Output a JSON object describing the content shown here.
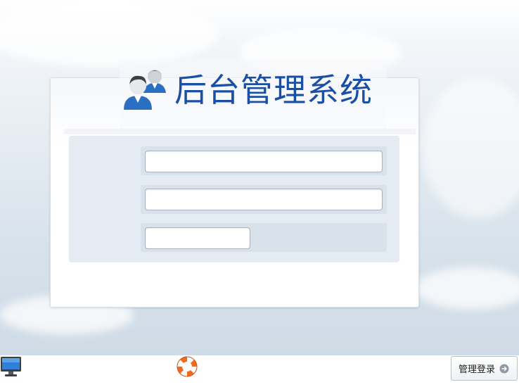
{
  "header": {
    "title": "后台管理系统",
    "logo_icon": "users-icon"
  },
  "form": {
    "username": {
      "value": "",
      "placeholder": ""
    },
    "password": {
      "value": "",
      "placeholder": ""
    },
    "captcha": {
      "value": "",
      "placeholder": ""
    }
  },
  "footer": {
    "login_button_label": "管理登录",
    "login_arrow_icon": "arrow-right-circle-icon",
    "left_icon": "monitor-icon",
    "center_icon": "lifebuoy-icon"
  },
  "colors": {
    "title": "#1a4fa3",
    "form_bg": "#e5ebf2",
    "icon_blue": "#2b6fc2"
  }
}
